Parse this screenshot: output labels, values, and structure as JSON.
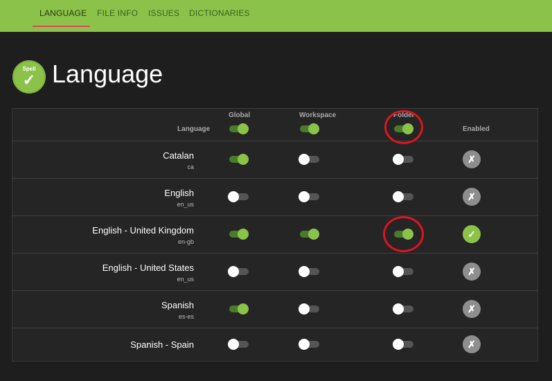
{
  "tabs": [
    {
      "label": "LANGUAGE",
      "active": true
    },
    {
      "label": "FILE INFO",
      "active": false
    },
    {
      "label": "ISSUES",
      "active": false
    },
    {
      "label": "DICTIONARIES",
      "active": false
    }
  ],
  "logo": {
    "text": "Spell",
    "check": "✓"
  },
  "page_title": "Language",
  "columns": {
    "language": "Language",
    "global": "Global",
    "workspace": "Workspace",
    "folder": "Folder",
    "enabled": "Enabled"
  },
  "header_toggles": {
    "global": true,
    "workspace": true,
    "folder": true
  },
  "rows": [
    {
      "name": "Catalan",
      "code": "ca",
      "global": true,
      "workspace": false,
      "folder": false,
      "enabled": false
    },
    {
      "name": "English",
      "code": "en_us",
      "global": false,
      "workspace": false,
      "folder": false,
      "enabled": false
    },
    {
      "name": "English - United Kingdom",
      "code": "en-gb",
      "global": true,
      "workspace": true,
      "folder": true,
      "enabled": true
    },
    {
      "name": "English - United States",
      "code": "en_us",
      "global": false,
      "workspace": false,
      "folder": false,
      "enabled": false
    },
    {
      "name": "Spanish",
      "code": "es-es",
      "global": true,
      "workspace": false,
      "folder": false,
      "enabled": false
    },
    {
      "name": "Spanish - Spain",
      "code": "",
      "global": false,
      "workspace": false,
      "folder": false,
      "enabled": false
    }
  ],
  "status_icons": {
    "on": "✓",
    "off": "✗"
  },
  "colors": {
    "accent": "#8bc34a",
    "highlight": "#e0141e",
    "tab_underline": "#e0445a"
  }
}
